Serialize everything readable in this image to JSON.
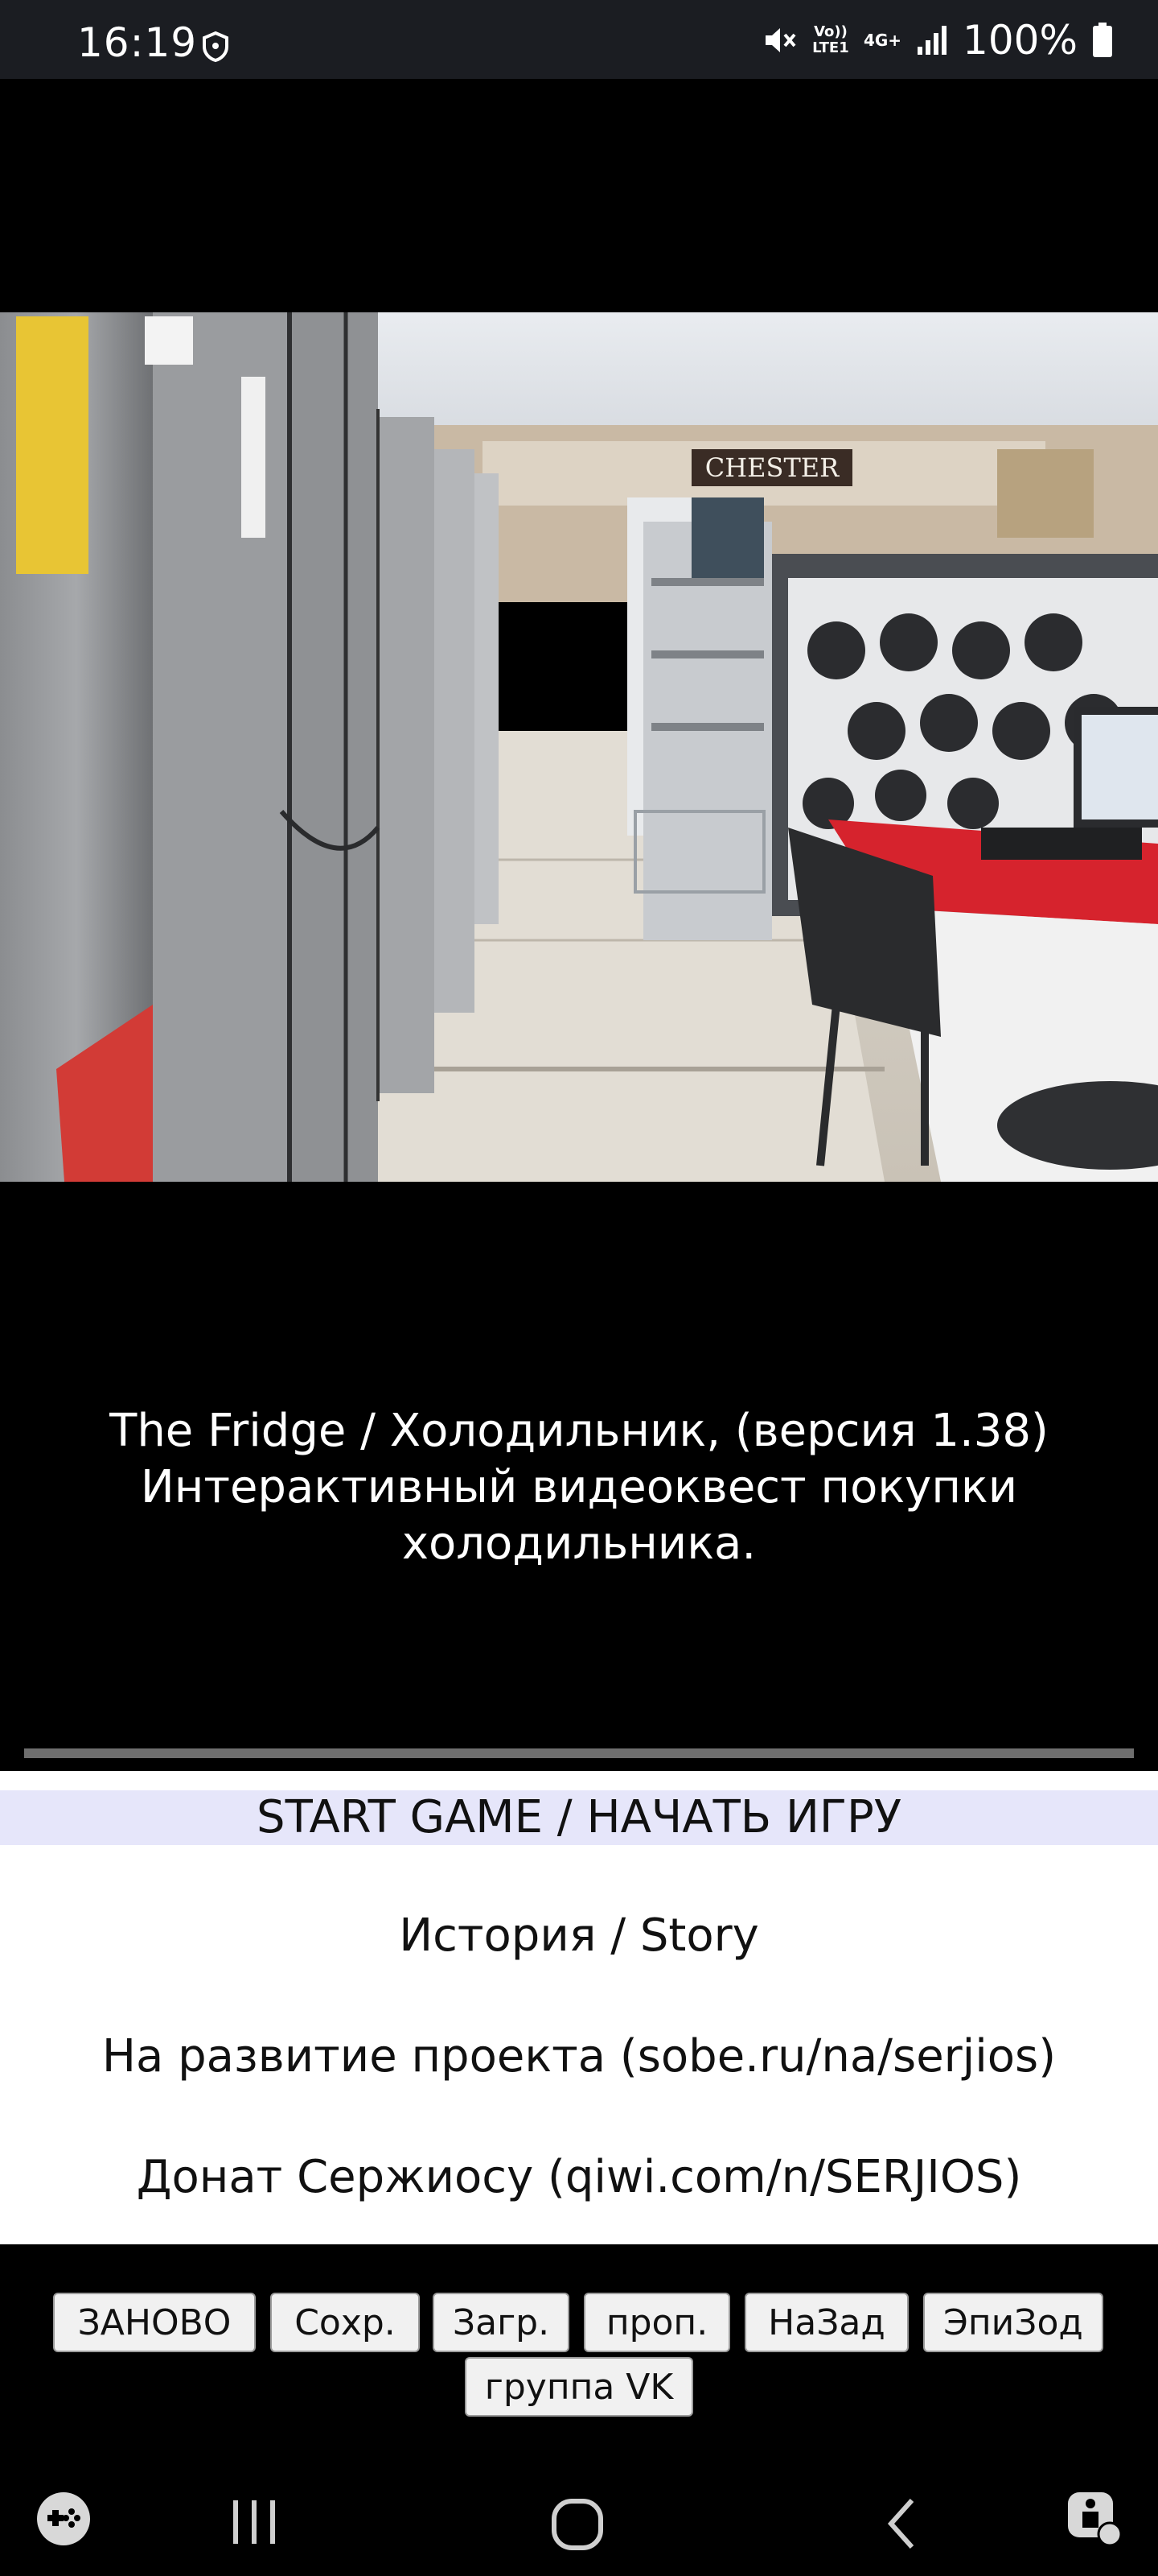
{
  "status": {
    "time": "16:19",
    "network_label": "Vo)) LTE1",
    "net_type": "4G+",
    "battery": "100%"
  },
  "video": {
    "store_sign": "CHESTER",
    "caption_lines": [
      "The Fridge / Холодильник, (версия 1.38)",
      "Интерактивный видеоквест покупки",
      "холодильника."
    ]
  },
  "menu": {
    "items": [
      {
        "label": "START GAME / НАЧАТЬ ИГРУ",
        "selected": true
      },
      {
        "label": "История / Story"
      },
      {
        "label": "На развитие проекта (sobe.ru/na/serjios)"
      },
      {
        "label": "Донат Сержиосу (qiwi.com/n/SERJIOS)"
      }
    ]
  },
  "toolbar": {
    "buttons": [
      "ЗАНОВО",
      "Сохр.",
      "Загр.",
      "проп.",
      "НаЗад",
      "ЭпиЗод",
      "группа VK"
    ]
  },
  "nav": {
    "icons": [
      "game-tools-icon",
      "recent-apps-icon",
      "home-icon",
      "back-icon",
      "accessibility-icon"
    ]
  }
}
